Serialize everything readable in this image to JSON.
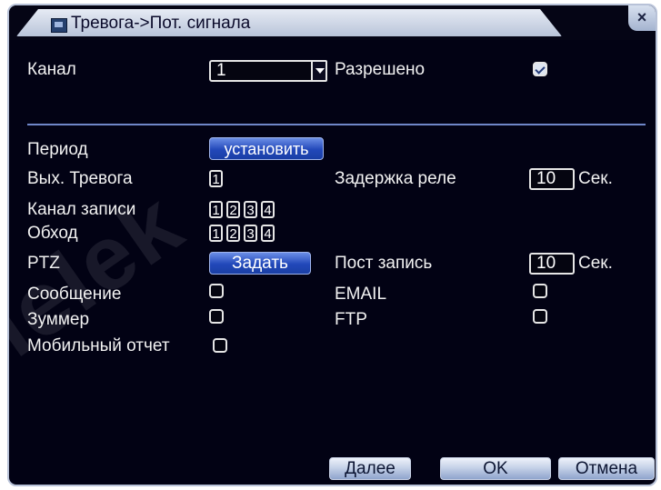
{
  "window": {
    "title": "Тревога->Пот. сигнала",
    "close_glyph": "×"
  },
  "row_channel": {
    "label": "Канал",
    "value": "1",
    "enabled_label": "Разрешено",
    "enabled": true
  },
  "period": {
    "label": "Период",
    "button": "установить"
  },
  "alarm_out": {
    "label": "Вых. Тревога",
    "channels": [
      "1"
    ]
  },
  "relay_delay": {
    "label": "Задержка реле",
    "value": "10",
    "unit": "Сек."
  },
  "record_channel": {
    "label": "Канал записи",
    "channels": [
      "1",
      "2",
      "3",
      "4"
    ]
  },
  "tour": {
    "label": "Обход",
    "channels": [
      "1",
      "2",
      "3",
      "4"
    ]
  },
  "ptz": {
    "label": "PTZ",
    "button": "Задать"
  },
  "post_record": {
    "label": "Пост запись",
    "value": "10",
    "unit": "Сек."
  },
  "message": {
    "label": "Сообщение"
  },
  "email": {
    "label": "EMAIL"
  },
  "buzzer": {
    "label": "Зуммер"
  },
  "ftp": {
    "label": "FTP"
  },
  "mobile_report": {
    "label": "Мобильный отчет"
  },
  "footer": {
    "next": "Далее",
    "ok": "OK",
    "cancel": "Отмена"
  },
  "watermark": "rielek",
  "colors": {
    "background": "#020214",
    "text": "#f2f2f2",
    "accent": "#2248b9"
  }
}
